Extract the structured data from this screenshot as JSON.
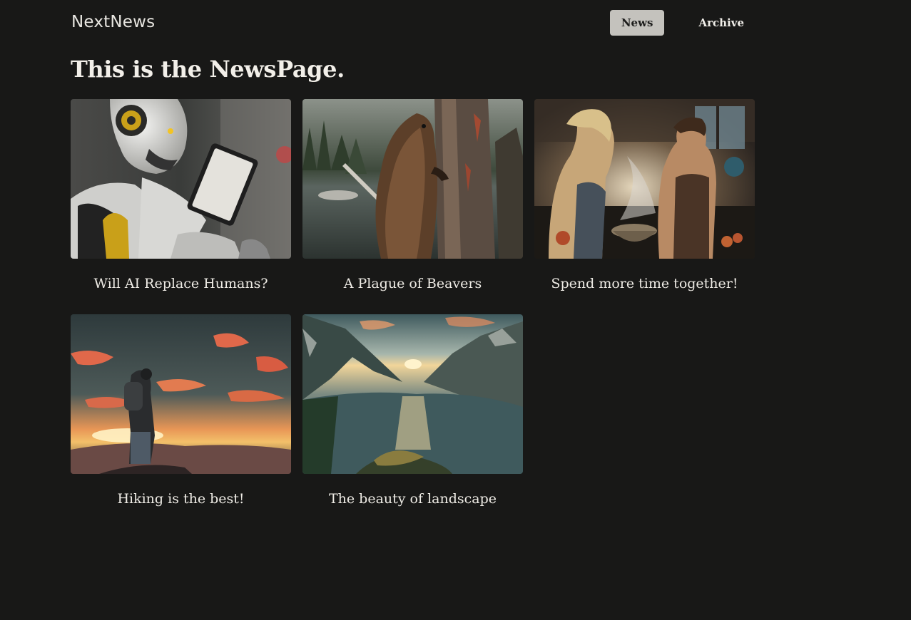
{
  "header": {
    "brand": "NextNews",
    "nav": [
      {
        "label": "News",
        "active": true
      },
      {
        "label": "Archive",
        "active": false
      }
    ]
  },
  "page": {
    "title": "This is the NewsPage."
  },
  "articles": [
    {
      "title": "Will AI Replace Humans?",
      "image": "robot-holding-tablet"
    },
    {
      "title": "A Plague of Beavers",
      "image": "beaver-on-tree-by-lake"
    },
    {
      "title": "Spend more time together!",
      "image": "couple-cooking-in-kitchen"
    },
    {
      "title": "Hiking is the best!",
      "image": "hiker-at-sunset"
    },
    {
      "title": "The beauty of landscape",
      "image": "mountain-lake-landscape"
    }
  ],
  "colors": {
    "background": "#181817",
    "text": "#ece9e3",
    "active_nav_bg": "#c4c2bd"
  }
}
